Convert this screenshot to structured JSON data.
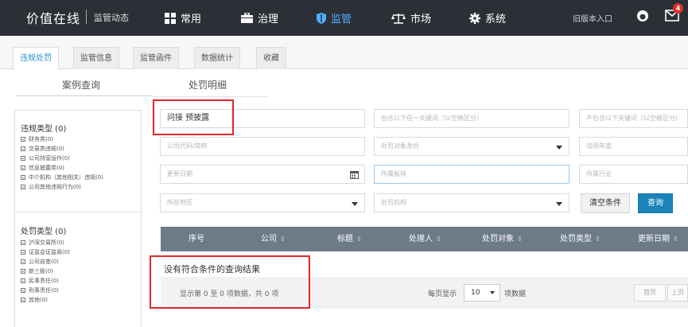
{
  "brand": {
    "name": "价值在线",
    "subtitle": "监管动态"
  },
  "nav": [
    {
      "label": "常用",
      "icon": "grid-icon",
      "active": false
    },
    {
      "label": "治理",
      "icon": "briefcase-icon",
      "active": false
    },
    {
      "label": "监管",
      "icon": "shield-icon",
      "active": true
    },
    {
      "label": "市场",
      "icon": "scale-icon",
      "active": false
    },
    {
      "label": "系统",
      "icon": "gear-icon",
      "active": false
    }
  ],
  "old_version_link": "旧版本入口",
  "notification_count": "4",
  "tabs": [
    {
      "label": "违规处罚",
      "active": true
    },
    {
      "label": "监管信息",
      "active": false
    },
    {
      "label": "监管函件",
      "active": false
    },
    {
      "label": "数据统计",
      "active": false
    },
    {
      "label": "收藏",
      "active": false
    }
  ],
  "subtabs": [
    {
      "label": "案例查询",
      "active": true
    },
    {
      "label": "处罚明细",
      "active": false
    }
  ],
  "violation_group": {
    "title": "违规类型 (0)",
    "items": [
      "财务类(0)",
      "交易类违规(0)",
      "公司持营运作(0)",
      "信息披露类(0)",
      "中介机构（其他相关）违规(0)",
      "公司其他违规行为(0)"
    ]
  },
  "penalty_group": {
    "title": "处罚类型 (0)",
    "items": [
      "沪深交易所(0)",
      "证监会证监局(0)",
      "公司自查(0)",
      "新三板(0)",
      "民事责任(0)",
      "刑事责任(0)",
      "其他(0)"
    ]
  },
  "filters": {
    "keyword": "问接 预披露",
    "include_any": "包含以下任一关键词（以空格区分）",
    "exclude_any": "不包含以下关键词（以空格区分）",
    "company_code": "公司代码/简称",
    "penalty_object_status": "处罚对象身份",
    "violation_year": "违规年度",
    "update_date": "更新日期",
    "board": "所属板块",
    "industry": "所属行业",
    "region": "所在地区",
    "agency": "处罚机构"
  },
  "buttons": {
    "clear": "清空条件",
    "search": "查询"
  },
  "table": {
    "columns": [
      "序号",
      "公司",
      "标题",
      "处理人",
      "处罚对象",
      "处罚类型",
      "更新日期"
    ],
    "sort_glyph": "⇕",
    "empty_text": "没有符合条件的查询结果",
    "summary": "显示第 0 至 0 项数据，共 0 项"
  },
  "pagination": {
    "per_page_label": "每页显示",
    "per_page_value": "10",
    "per_page_suffix": "项数据",
    "prev_label": "首页",
    "next_label": "上页"
  }
}
